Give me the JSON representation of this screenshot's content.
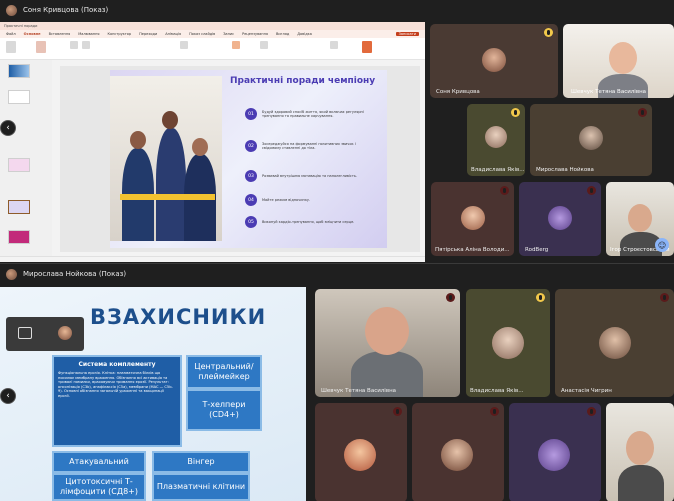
{
  "top": {
    "presenter_title": "Соня Кривцова (Показ)",
    "ppt": {
      "file_title": "Практичні поради",
      "tabs": [
        "Файл",
        "Основне",
        "Вставлення",
        "Малювання",
        "Конструктор",
        "Переходи",
        "Анімація",
        "Показ слайдів",
        "Запис",
        "Рецензування",
        "Вигляд",
        "Довідка"
      ],
      "record_button": "Записати",
      "slide": {
        "title": "Практичні поради чемпіону",
        "tips": [
          {
            "num": "01",
            "text": "Будуй здоровий спосіб життя, який включає регулярні тренування та правильне харчування."
          },
          {
            "num": "02",
            "text": "Зосереджуйся на формуванні позитивних звичок і свідомому ставленні до тіла."
          },
          {
            "num": "03",
            "text": "Розвивай внутрішню мотивацію та наполегливість."
          },
          {
            "num": "04",
            "text": "Майте режим відпочинку."
          },
          {
            "num": "05",
            "text": "Виконуй кардіо-тренування, щоб зміцнити серце."
          }
        ]
      }
    },
    "participants": [
      {
        "name": "Соня Кривцова",
        "mic": "yellow"
      },
      {
        "name": "Шевчук Тетяна Василівна",
        "mic": "none"
      },
      {
        "name": "Владислава Яків...",
        "mic": "yellow"
      },
      {
        "name": "Мирослава Нойкова",
        "mic": "red"
      },
      {
        "name": "Пятірська Аліна Володи...",
        "mic": "red"
      },
      {
        "name": "RodBerg",
        "mic": "red"
      },
      {
        "name": "Ігор Строєстовський",
        "mic": "none"
      }
    ]
  },
  "bottom": {
    "presenter_title": "Мирослава Нойкова (Показ)",
    "slide": {
      "title": "ВЗАХИСНИКИ",
      "complement_title": "Система комплементу",
      "complement_text": "Функціональна ерозія. Клітка: плазматична білків що посилює мембрану враження. Обізнання всі активація та тривалі помилки, враховуючи тримання ерозії. Результат: опсонізація (C3b), анафілаксія (C5a), мембрани (MAC — C5b-9). Основні обізнання загальній ураженні та вакцинації ерозії.",
      "boxes": [
        {
          "id": "central",
          "label": "Центральний/ плеймейкер"
        },
        {
          "id": "helpers",
          "label": "Т-хелпери (CD4+)"
        },
        {
          "id": "attack",
          "label": "Атакувальний"
        },
        {
          "id": "cytotoxic",
          "label": "Цитотоксичні Т-лімфоцити (CД8+)"
        },
        {
          "id": "winger",
          "label": "Вінгер"
        },
        {
          "id": "plasma",
          "label": "Плазматичні клітини"
        }
      ]
    },
    "participants": [
      {
        "name": "Шевчук Тетяна Василівна",
        "mic": "red"
      },
      {
        "name": "Владислава Яків...",
        "mic": "yellow"
      },
      {
        "name": "Анастасія Чигрин",
        "mic": "red"
      },
      {
        "name": "",
        "mic": "red"
      },
      {
        "name": "",
        "mic": "red"
      },
      {
        "name": "",
        "mic": "red"
      },
      {
        "name": "",
        "mic": "none"
      }
    ]
  }
}
